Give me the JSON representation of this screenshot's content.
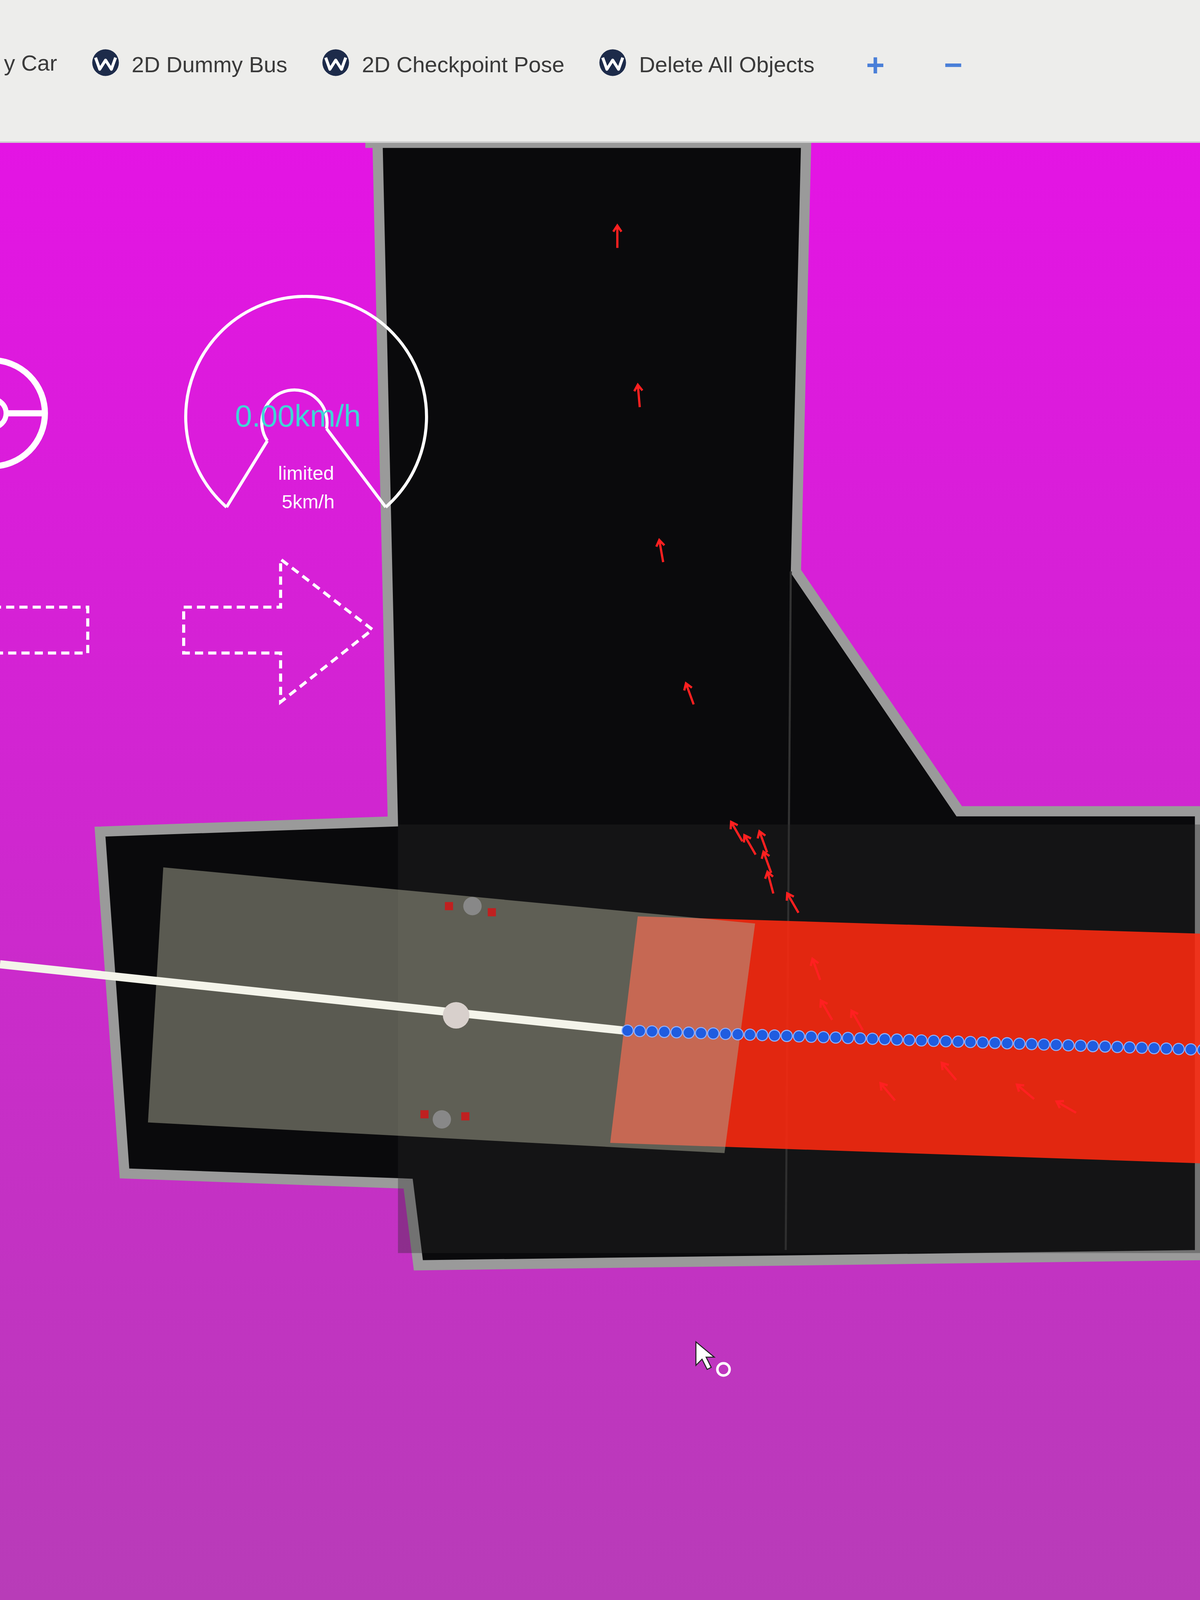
{
  "toolbar": {
    "tools": [
      {
        "label": "y Car",
        "kind": "text"
      },
      {
        "label": "2D Dummy Bus",
        "kind": "logo"
      },
      {
        "label": "2D Checkpoint Pose",
        "kind": "logo"
      },
      {
        "label": "Delete All Objects",
        "kind": "logo"
      }
    ],
    "buttons": [
      {
        "label": "+"
      },
      {
        "label": "−"
      }
    ]
  },
  "speed": {
    "value": "0.00km/h",
    "limit_label": "limited",
    "limit": "5km/h"
  },
  "turn_signals": [
    {
      "direction": "left",
      "on": false
    },
    {
      "direction": "right",
      "on": false
    }
  ]
}
